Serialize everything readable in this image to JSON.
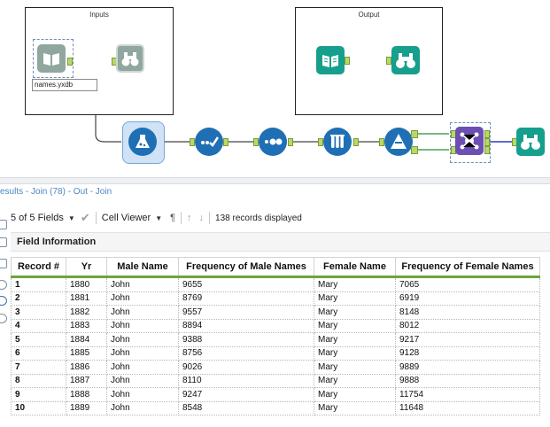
{
  "canvas": {
    "container_inputs_title": "Inputs",
    "container_output_title": "Output",
    "input_tool_caption": "names.yxdb",
    "colors": {
      "teal": "#169f8c",
      "blue": "#1f6fb5",
      "purple": "#6b4fb2",
      "anchor": "#b6d96a"
    }
  },
  "results": {
    "title": "esults - Join (78) - Out - Join"
  },
  "toolbar": {
    "fields_label": "5 of 5 Fields",
    "cell_viewer_label": "Cell Viewer",
    "records_label": "138 records displayed"
  },
  "field_info": {
    "label": "Field Information"
  },
  "table": {
    "headers": [
      "Record #",
      "Yr",
      "Male Name",
      "Frequency of Male Names",
      "Female Name",
      "Frequency of Female Names"
    ],
    "rows": [
      [
        "1",
        "1880",
        "John",
        "9655",
        "Mary",
        "7065"
      ],
      [
        "2",
        "1881",
        "John",
        "8769",
        "Mary",
        "6919"
      ],
      [
        "3",
        "1882",
        "John",
        "9557",
        "Mary",
        "8148"
      ],
      [
        "4",
        "1883",
        "John",
        "8894",
        "Mary",
        "8012"
      ],
      [
        "5",
        "1884",
        "John",
        "9388",
        "Mary",
        "9217"
      ],
      [
        "6",
        "1885",
        "John",
        "8756",
        "Mary",
        "9128"
      ],
      [
        "7",
        "1886",
        "John",
        "9026",
        "Mary",
        "9889"
      ],
      [
        "8",
        "1887",
        "John",
        "8110",
        "Mary",
        "9888"
      ],
      [
        "9",
        "1888",
        "John",
        "9247",
        "Mary",
        "11754"
      ],
      [
        "10",
        "1889",
        "John",
        "8548",
        "Mary",
        "11648"
      ]
    ]
  }
}
